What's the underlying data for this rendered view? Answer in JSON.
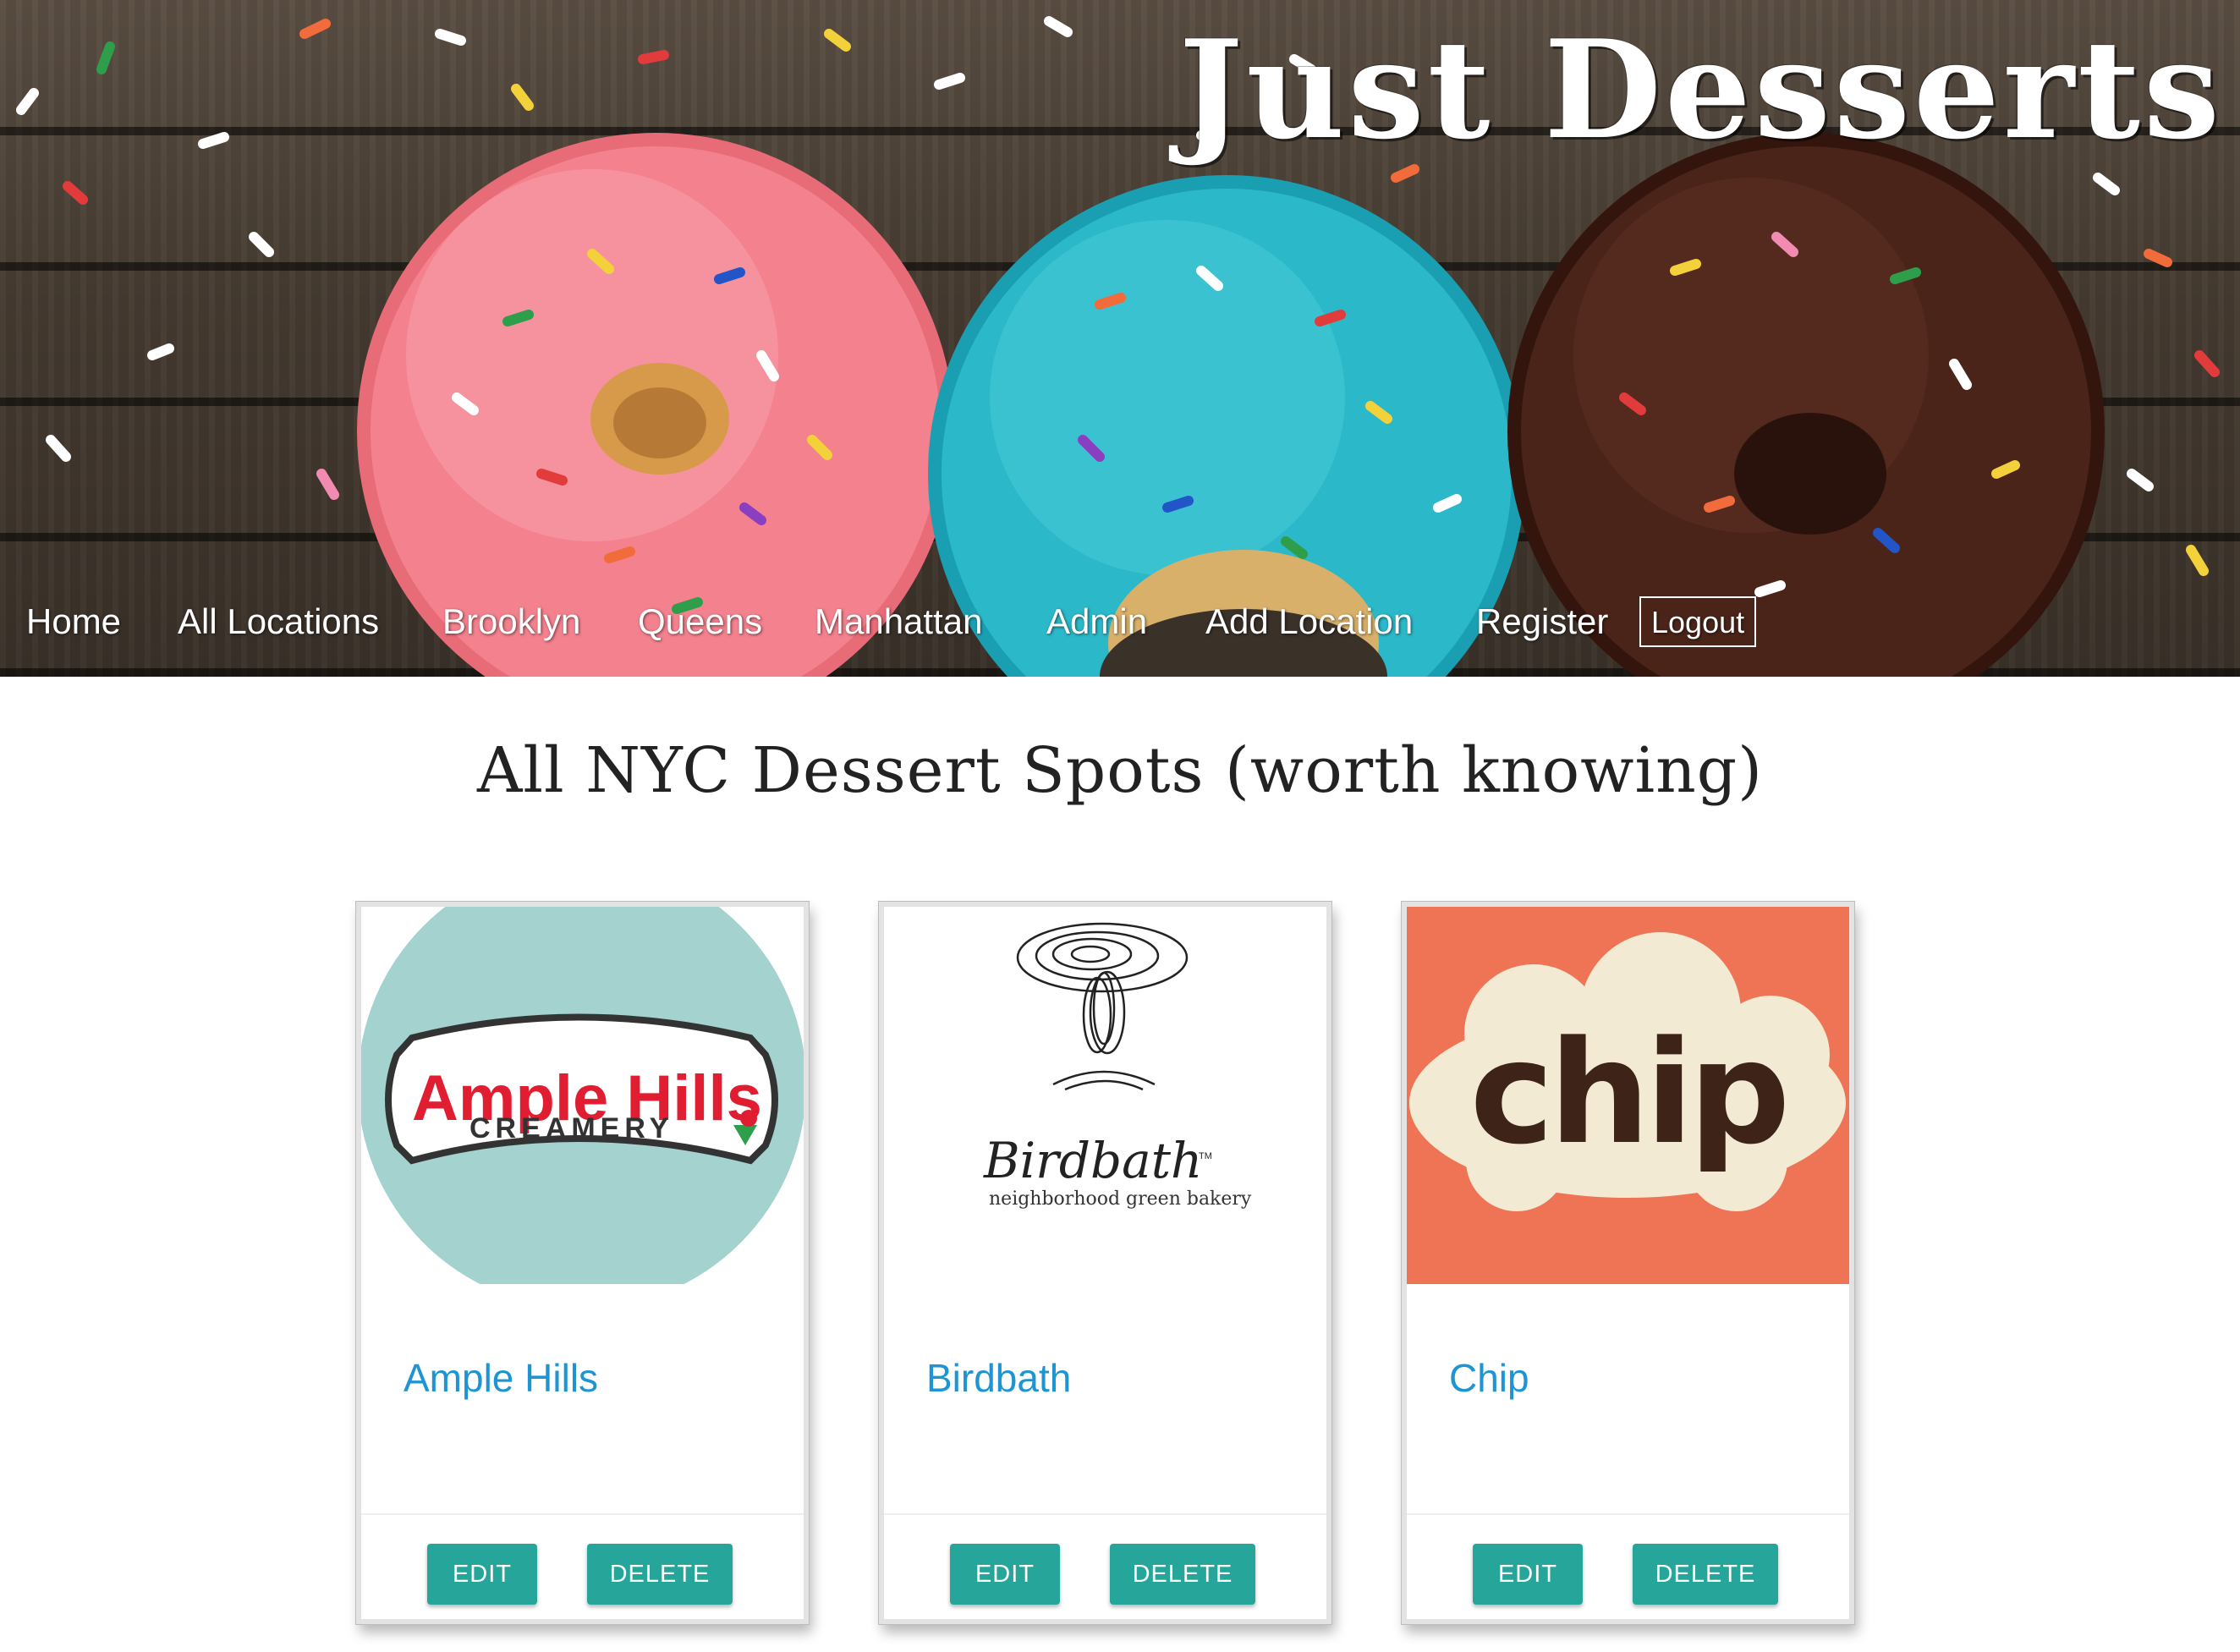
{
  "brand": {
    "title": "Just Desserts"
  },
  "nav": {
    "items": [
      {
        "label": "Home"
      },
      {
        "label": "All Locations"
      },
      {
        "label": "Brooklyn"
      },
      {
        "label": "Queens"
      },
      {
        "label": "Manhattan"
      },
      {
        "label": "Admin"
      },
      {
        "label": "Add Location"
      },
      {
        "label": "Register"
      }
    ],
    "logout": {
      "label": "Logout"
    }
  },
  "page": {
    "title": "All NYC Dessert Spots (worth knowing)"
  },
  "cards": [
    {
      "name": "Ample Hills",
      "logo": {
        "line1": "Ample Hills",
        "line2": "CREAMERY"
      },
      "edit_label": "EDIT",
      "delete_label": "DELETE"
    },
    {
      "name": "Birdbath",
      "logo": {
        "line1": "Birdbath",
        "line2": "neighborhood green bakery",
        "tm": "TM"
      },
      "edit_label": "EDIT",
      "delete_label": "DELETE"
    },
    {
      "name": "Chip",
      "logo": {
        "line1": "chip"
      },
      "edit_label": "EDIT",
      "delete_label": "DELETE"
    }
  ],
  "colors": {
    "accent_button": "#26a69a",
    "link": "#1e94d2",
    "hero_wood": "#453b31",
    "ample_circle": "#a3d2cf",
    "ample_red": "#e11d32",
    "chip_bg": "#ef7455",
    "chip_cloud": "#f2ead2",
    "chip_text": "#3e2418"
  },
  "images": {
    "hero": "donuts-with-sprinkles",
    "donuts": [
      "pink-frosted-donut",
      "blue-frosted-donut",
      "chocolate-frosted-donut"
    ]
  }
}
